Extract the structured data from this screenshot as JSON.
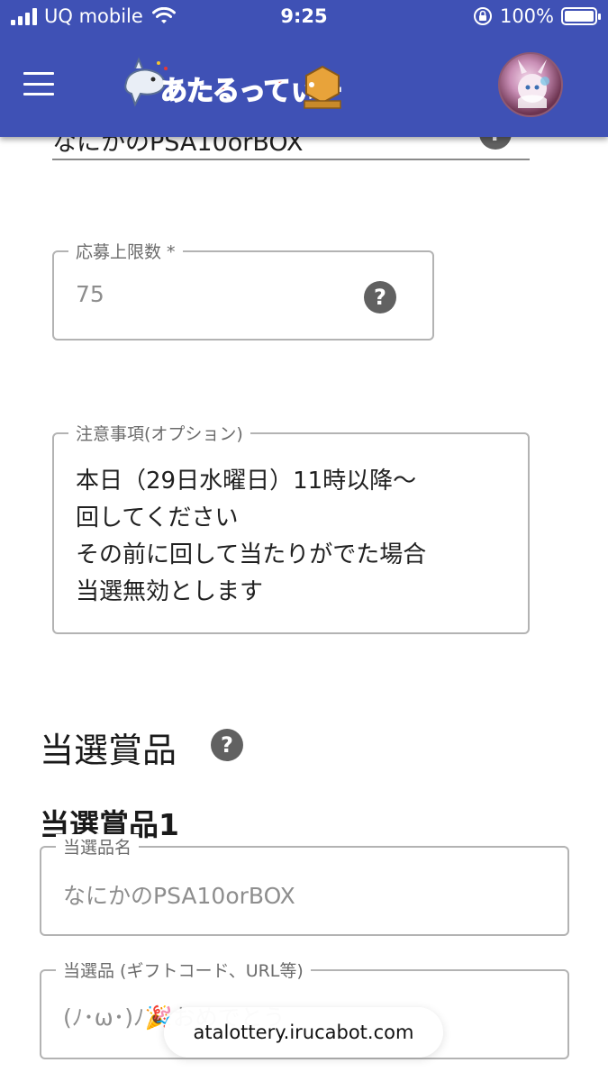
{
  "status_bar": {
    "carrier": "UQ mobile",
    "time": "9:25",
    "battery": "100%",
    "battery_level": 1.0
  },
  "header": {
    "logo_text": "あたるってぃー",
    "menu_icon": "hamburger-icon",
    "avatar_icon": "user-avatar"
  },
  "form": {
    "partial_field_value": "なにかのPSA10orBOX",
    "max_entries": {
      "label": "応募上限数 *",
      "value": "75"
    },
    "notes": {
      "label": "注意事項(オプション)",
      "lines": [
        "本日（29日水曜日）11時以降〜",
        "回してください",
        "その前に回して当たりがでた場合",
        "当選無効とします"
      ]
    },
    "prizes": {
      "title": "当選賞品",
      "prize1": {
        "title": "当選賞品1",
        "name_label": "当選品名",
        "name_value": "なにかのPSA10orBOX",
        "content_label": "当選品 (ギフトコード、URL等)",
        "content_value": "(ﾉ･ω･)ﾉ🎉おめでとう"
      }
    }
  },
  "browser": {
    "url": "atalottery.irucabot.com"
  },
  "colors": {
    "header_bg": "#3f51b5",
    "logo_red": "#e53935",
    "help_icon": "#616161"
  }
}
